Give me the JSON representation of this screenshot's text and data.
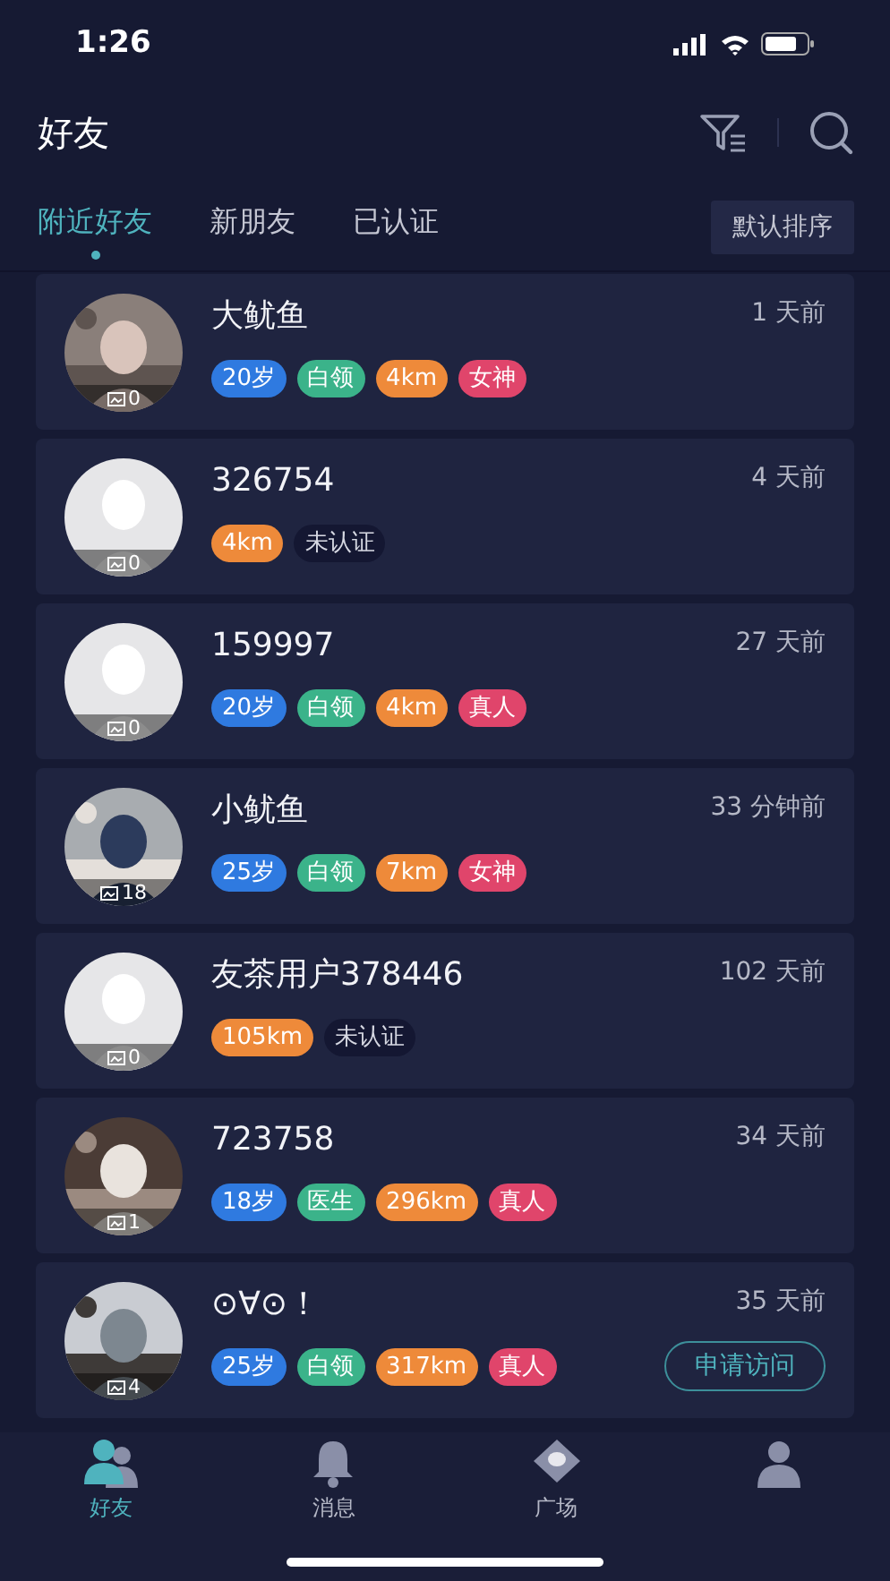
{
  "status_bar": {
    "time": "1:26"
  },
  "header": {
    "title": "好友"
  },
  "tabs": [
    {
      "label": "附近好友",
      "selected": true
    },
    {
      "label": "新朋友",
      "selected": false
    },
    {
      "label": "已认证",
      "selected": false
    }
  ],
  "sort_button": {
    "label": "默认排序"
  },
  "friends": [
    {
      "name": "大鱿鱼",
      "time": "1 天前",
      "photo_count": "0",
      "tags": [
        {
          "text": "20岁",
          "kind": "age"
        },
        {
          "text": "白领",
          "kind": "job"
        },
        {
          "text": "4km",
          "kind": "distance"
        },
        {
          "text": "女神",
          "kind": "badge"
        }
      ]
    },
    {
      "name": "326754",
      "time": "4 天前",
      "avatar": {
        "kind": "default"
      },
      "photo_count": "0",
      "tags": [
        {
          "text": "4km",
          "kind": "distance"
        },
        {
          "text": "未认证",
          "kind": "unverified"
        }
      ]
    },
    {
      "name": "159997",
      "time": "27 天前",
      "avatar": {
        "kind": "default"
      },
      "photo_count": "0",
      "tags": [
        {
          "text": "20岁",
          "kind": "age"
        },
        {
          "text": "白领",
          "kind": "job"
        },
        {
          "text": "4km",
          "kind": "distance"
        },
        {
          "text": "真人",
          "kind": "badge"
        }
      ]
    },
    {
      "name": "小鱿鱼",
      "time": "33 分钟前",
      "photo_count": "18",
      "tags": [
        {
          "text": "25岁",
          "kind": "age"
        },
        {
          "text": "白领",
          "kind": "job"
        },
        {
          "text": "7km",
          "kind": "distance"
        },
        {
          "text": "女神",
          "kind": "badge"
        }
      ]
    },
    {
      "name": "友茶用户378446",
      "time": "102 天前",
      "avatar": {
        "kind": "default"
      },
      "photo_count": "0",
      "tags": [
        {
          "text": "105km",
          "kind": "distance"
        },
        {
          "text": "未认证",
          "kind": "unverified"
        }
      ]
    },
    {
      "name": "723758",
      "time": "34 天前",
      "photo_count": "1",
      "tags": [
        {
          "text": "18岁",
          "kind": "age"
        },
        {
          "text": "医生",
          "kind": "job"
        },
        {
          "text": "296km",
          "kind": "distance"
        },
        {
          "text": "真人",
          "kind": "badge"
        }
      ]
    },
    {
      "name": "⊙∀⊙！",
      "time": "35 天前",
      "photo_count": "4",
      "tags": [
        {
          "text": "25岁",
          "kind": "age"
        },
        {
          "text": "白领",
          "kind": "job"
        },
        {
          "text": "317km",
          "kind": "distance"
        },
        {
          "text": "真人",
          "kind": "badge"
        }
      ],
      "action": "申请访问"
    }
  ],
  "bottom_nav": [
    {
      "label": "好友",
      "kind": "friends",
      "selected": true
    },
    {
      "label": "消息",
      "kind": "bell",
      "selected": false
    },
    {
      "label": "广场",
      "kind": "square",
      "selected": false
    },
    {
      "kind": "person",
      "selected": false
    }
  ]
}
